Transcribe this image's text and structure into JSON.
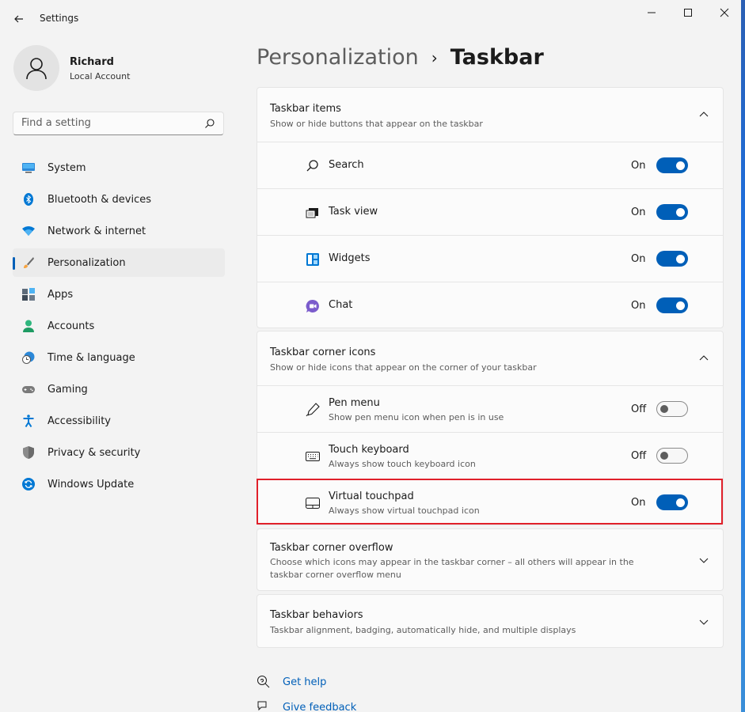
{
  "window": {
    "title": "Settings"
  },
  "profile": {
    "name": "Richard",
    "account_type": "Local Account"
  },
  "search": {
    "placeholder": "Find a setting"
  },
  "nav": {
    "items": [
      {
        "label": "System",
        "icon": "system-icon",
        "active": false
      },
      {
        "label": "Bluetooth & devices",
        "icon": "bluetooth-icon",
        "active": false
      },
      {
        "label": "Network & internet",
        "icon": "wifi-icon",
        "active": false
      },
      {
        "label": "Personalization",
        "icon": "paintbrush-icon",
        "active": true
      },
      {
        "label": "Apps",
        "icon": "apps-icon",
        "active": false
      },
      {
        "label": "Accounts",
        "icon": "accounts-icon",
        "active": false
      },
      {
        "label": "Time & language",
        "icon": "clock-globe-icon",
        "active": false
      },
      {
        "label": "Gaming",
        "icon": "gamepad-icon",
        "active": false
      },
      {
        "label": "Accessibility",
        "icon": "accessibility-icon",
        "active": false
      },
      {
        "label": "Privacy & security",
        "icon": "shield-icon",
        "active": false
      },
      {
        "label": "Windows Update",
        "icon": "update-icon",
        "active": false
      }
    ]
  },
  "breadcrumb": {
    "parent": "Personalization",
    "separator": "›",
    "current": "Taskbar"
  },
  "taskbar_items": {
    "title": "Taskbar items",
    "description": "Show or hide buttons that appear on the taskbar",
    "rows": [
      {
        "label": "Search",
        "state": "On"
      },
      {
        "label": "Task view",
        "state": "On"
      },
      {
        "label": "Widgets",
        "state": "On"
      },
      {
        "label": "Chat",
        "state": "On"
      }
    ]
  },
  "corner_icons": {
    "title": "Taskbar corner icons",
    "description": "Show or hide icons that appear on the corner of your taskbar",
    "rows": [
      {
        "label": "Pen menu",
        "sub": "Show pen menu icon when pen is in use",
        "state": "Off"
      },
      {
        "label": "Touch keyboard",
        "sub": "Always show touch keyboard icon",
        "state": "Off"
      },
      {
        "label": "Virtual touchpad",
        "sub": "Always show virtual touchpad icon",
        "state": "On"
      }
    ]
  },
  "corner_overflow": {
    "title": "Taskbar corner overflow",
    "description": "Choose which icons may appear in the taskbar corner – all others will appear in the taskbar corner overflow menu"
  },
  "behaviors": {
    "title": "Taskbar behaviors",
    "description": "Taskbar alignment, badging, automatically hide, and multiple displays"
  },
  "help": {
    "get_help": "Get help",
    "give_feedback": "Give feedback"
  },
  "colors": {
    "accent": "#005fb8",
    "highlight_border": "#e0202a"
  }
}
